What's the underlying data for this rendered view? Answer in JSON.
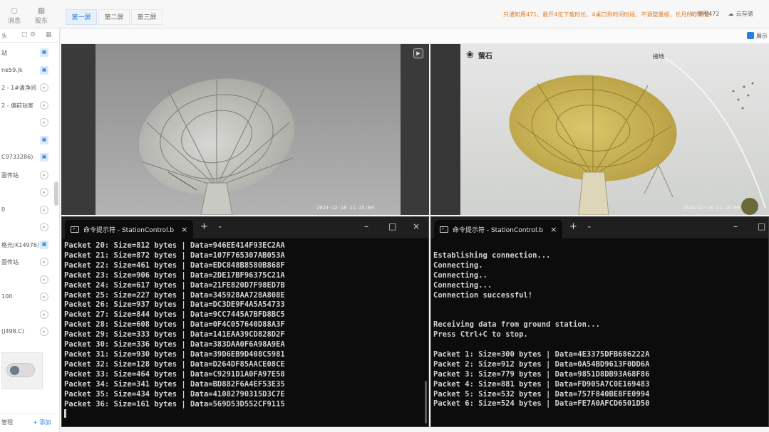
{
  "topbar": {
    "nav": [
      {
        "label": "消息",
        "icon": "chat-icon"
      },
      {
        "label": "股东",
        "icon": "grid-icon"
      }
    ],
    "tabs": [
      {
        "label": "第一屏",
        "active": true
      },
      {
        "label": "第二屏",
        "active": false
      },
      {
        "label": "第三屏",
        "active": false
      }
    ],
    "notice": "只通知用471、最开4位下载时长、4桌口到时间时段、不调整量级、长月所示单位！",
    "right": [
      {
        "label": "使用472",
        "icon": "crown-icon"
      },
      {
        "label": "云存储",
        "icon": "cloud-icon"
      }
    ]
  },
  "subbar": {
    "checkbox_label": "展示"
  },
  "sidebar": {
    "header": "头",
    "items": [
      {
        "label": "站",
        "status": "on"
      },
      {
        "label": "ne59.jk",
        "status": "on"
      },
      {
        "label": "2 - 1#清净间",
        "status": "off"
      },
      {
        "label": "2 - 偏前站室",
        "status": "off"
      },
      {
        "label": "",
        "status": "off"
      },
      {
        "label": "",
        "status": "on"
      },
      {
        "label": "C9733286)",
        "status": "on"
      },
      {
        "label": "面传站",
        "status": "off"
      },
      {
        "label": "",
        "status": "off"
      },
      {
        "label": "0",
        "status": "off"
      },
      {
        "label": "",
        "status": "off"
      },
      {
        "label": "格光(K14976)",
        "status": "on"
      },
      {
        "label": "面传站",
        "status": "off"
      },
      {
        "label": "",
        "status": "off"
      },
      {
        "label": "100",
        "status": "off"
      },
      {
        "label": "",
        "status": "off"
      },
      {
        "label": "(J498.C)",
        "status": "off"
      }
    ],
    "manage_label": "管理",
    "add_label": "+ 添加"
  },
  "videos": [
    {
      "timestamp": "2024-12-18 11:15:09",
      "brand": "",
      "label": ""
    },
    {
      "timestamp": "2024-12-18 11:15:09",
      "brand": "萤石",
      "label": "接地"
    }
  ],
  "terminals": [
    {
      "title": "命令提示符 - StationControl.b",
      "lines": [
        "Packet 20: Size=812 bytes | Data=946EE414F93EC2AA",
        "Packet 21: Size=872 bytes | Data=107F765307AB053A",
        "Packet 22: Size=461 bytes | Data=EDC848B8580B868F",
        "Packet 23: Size=906 bytes | Data=2DE17BF96375C21A",
        "Packet 24: Size=617 bytes | Data=21FE820D7F98ED7B",
        "Packet 25: Size=227 bytes | Data=345928AA728A808E",
        "Packet 26: Size=937 bytes | Data=DC3DE9F4A5A54733",
        "Packet 27: Size=844 bytes | Data=9CC7445A7BFD8BC5",
        "Packet 28: Size=608 bytes | Data=0F4C057640D88A3F",
        "Packet 29: Size=333 bytes | Data=141EAA39CD828D2F",
        "Packet 30: Size=336 bytes | Data=383DAA0F6A98A9EA",
        "Packet 31: Size=930 bytes | Data=39D6EB9D408C5981",
        "Packet 32: Size=128 bytes | Data=D264DF85AACE08CE",
        "Packet 33: Size=464 bytes | Data=C9291D1A0FA97E58",
        "Packet 34: Size=341 bytes | Data=BD882F6A4EF53E35",
        "Packet 35: Size=434 bytes | Data=41082790315D3C7E",
        "Packet 36: Size=161 bytes | Data=569D53D552CF9115"
      ]
    },
    {
      "title": "命令提示符 - StationControl.b",
      "lines": [
        "",
        "Establishing connection...",
        "Connecting.",
        "Connecting..",
        "Connecting...",
        "Connection successful!",
        "",
        "",
        "Receiving data from ground station...",
        "Press Ctrl+C to stop.",
        "",
        "Packet 1: Size=300 bytes | Data=4E3375DFB686222A",
        "Packet 2: Size=912 bytes | Data=0A54BD9613F0DD6A",
        "Packet 3: Size=779 bytes | Data=9851D8DB93A68F86",
        "Packet 4: Size=881 bytes | Data=FD905A7C0E169483",
        "Packet 5: Size=532 bytes | Data=757F840BE8FE0994",
        "Packet 6: Size=524 bytes | Data=FE7A0AFCD6501D50"
      ]
    }
  ]
}
